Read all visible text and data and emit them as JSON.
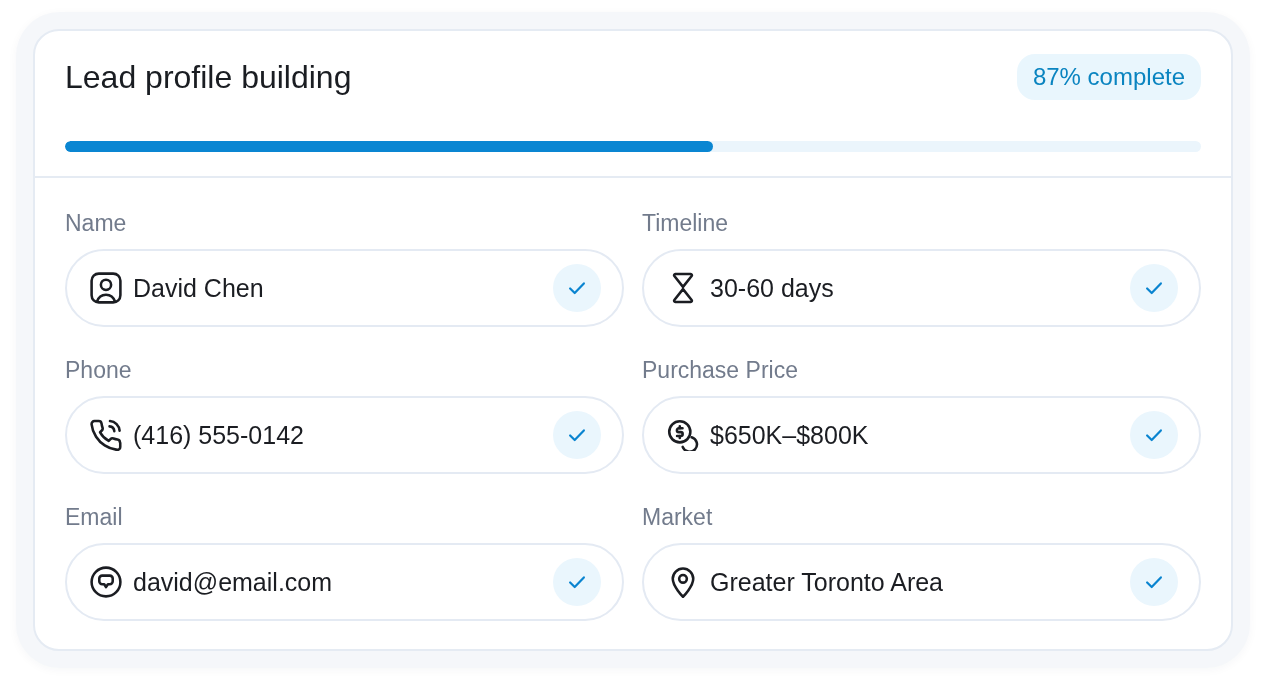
{
  "card": {
    "title": "Lead profile building",
    "completion": "87% complete"
  },
  "progress": {
    "level": 0.57
  },
  "fields": [
    {
      "label": "Name",
      "kind": "name",
      "value": "David Chen",
      "checked": true
    },
    {
      "label": "Timeline",
      "kind": "timeline",
      "value": "30-60 days",
      "checked": true
    },
    {
      "label": "Phone",
      "kind": "phone",
      "value": "(416) 555-0142",
      "checked": true
    },
    {
      "label": "Purchase Price",
      "kind": "price",
      "value": "$650K–$800K",
      "checked": true
    },
    {
      "label": "Email",
      "kind": "email",
      "value": "david@email.com",
      "checked": true
    },
    {
      "label": "Market",
      "kind": "market",
      "value": "Greater Toronto Area",
      "checked": true
    }
  ]
}
